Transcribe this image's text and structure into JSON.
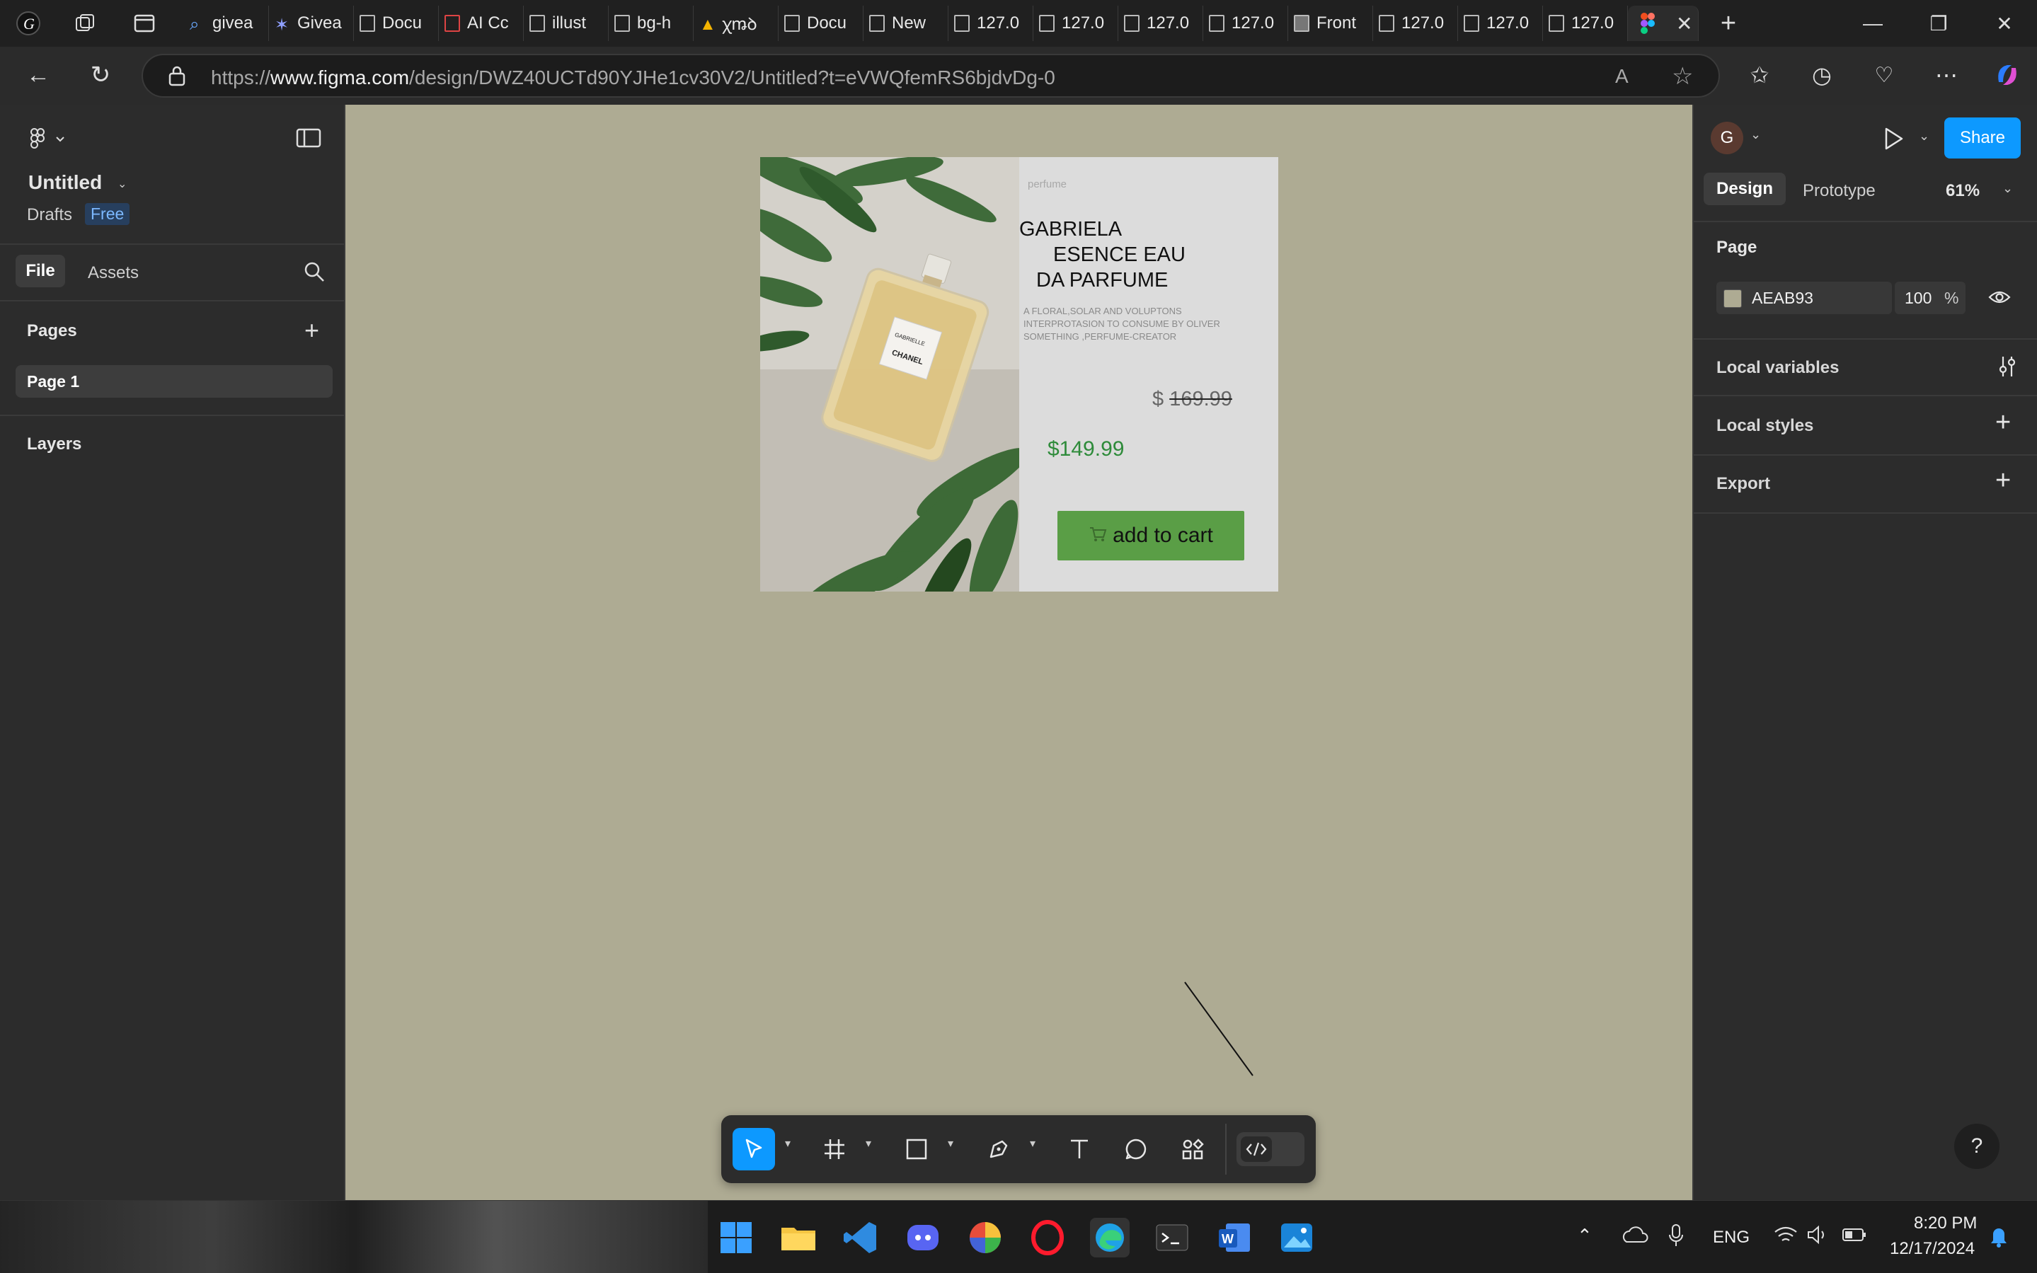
{
  "browser": {
    "tabs": [
      {
        "label": "givea"
      },
      {
        "label": "Givea"
      },
      {
        "label": "Docu"
      },
      {
        "label": "AI Cc"
      },
      {
        "label": "illust"
      },
      {
        "label": "bg-h"
      },
      {
        "label": "ꭓꬺꝺ"
      },
      {
        "label": "Docu"
      },
      {
        "label": "New"
      },
      {
        "label": "127.0"
      },
      {
        "label": "127.0"
      },
      {
        "label": "127.0"
      },
      {
        "label": "127.0"
      },
      {
        "label": "Front"
      },
      {
        "label": "127.0"
      },
      {
        "label": "127.0"
      },
      {
        "label": "127.0"
      }
    ],
    "url_prefix": "https://",
    "url_domain": "www.figma.com",
    "url_path": "/design/DWZ40UCTd90YJHe1cv30V2/Untitled?t=eVWQfemRS6bjdvDg-0"
  },
  "figma": {
    "file_title": "Untitled",
    "drafts_label": "Drafts",
    "plan_badge": "Free",
    "tab_file": "File",
    "tab_assets": "Assets",
    "pages_label": "Pages",
    "page_item": "Page 1",
    "layers_label": "Layers",
    "avatar_letter": "G",
    "share_label": "Share",
    "tab_design": "Design",
    "tab_prototype": "Prototype",
    "zoom": "61%",
    "page_section": "Page",
    "bg_color_hex": "AEAB93",
    "bg_color": "#aeab93",
    "opacity_value": "100",
    "opacity_unit": "%",
    "local_variables": "Local variables",
    "local_styles": "Local styles",
    "export_label": "Export",
    "help_label": "?"
  },
  "card": {
    "category": "perfume",
    "title_line1": "GABRIELA",
    "title_line2": "ESENCE EAU",
    "title_line3": "DA PARFUME",
    "description_line1": "A FLORAL,SOLAR AND VOLUPTONS",
    "description_line2": "INTERPROTASION TO CONSUME BY OLIVER",
    "description_line3": "SOMETHING ,PERFUME-CREATOR",
    "old_price_symbol": "$",
    "old_price": "169.99",
    "new_price": "$149.99",
    "cart_button": "add to cart",
    "bottle_text1": "GABRIELLE",
    "bottle_text2": "CHANEL",
    "price_color": "#2e8b3a",
    "button_color": "#5a9e46"
  },
  "taskbar": {
    "lang": "ENG",
    "time": "8:20 PM",
    "date": "12/17/2024"
  }
}
